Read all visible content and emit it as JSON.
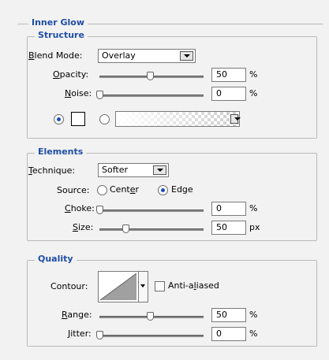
{
  "inner_glow": {
    "title": "Inner Glow",
    "structure": {
      "title": "Structure",
      "blend_mode": {
        "label_prefix": "B",
        "label_rest": "lend Mode:",
        "value": "Overlay"
      },
      "opacity": {
        "label_prefix": "O",
        "label_rest": "pacity:",
        "value": "50",
        "unit": "%",
        "slider_fraction": 0.5
      },
      "noise": {
        "label_prefix": "N",
        "label_rest": "oise:",
        "value": "0",
        "unit": "%",
        "slider_fraction": 0.0
      }
    },
    "elements": {
      "title": "Elements",
      "technique": {
        "label_prefix": "T",
        "label_rest": "echnique:",
        "value": "Softer"
      },
      "source": {
        "label": "Source:",
        "center_prefix": "Cent",
        "center_u": "e",
        "center_rest": "r",
        "edge": "Edge",
        "selected": "Edge"
      },
      "choke": {
        "label_prefix": "C",
        "label_rest": "hoke:",
        "value": "0",
        "unit": "%",
        "slider_fraction": 0.0
      },
      "size": {
        "label_prefix": "S",
        "label_rest": "ize:",
        "value": "50",
        "unit": "px",
        "slider_fraction": 0.25
      }
    },
    "quality": {
      "title": "Quality",
      "contour_label": "Contour:",
      "anti_aliased": {
        "prefix": "Anti-a",
        "u": "l",
        "rest": "iased",
        "checked": false
      },
      "range": {
        "label_prefix": "R",
        "label_rest": "ange:",
        "value": "50",
        "unit": "%",
        "slider_fraction": 0.5
      },
      "jitter": {
        "label_prefix": "J",
        "label_rest": "itter:",
        "value": "0",
        "unit": "%",
        "slider_fraction": 0.0
      }
    }
  }
}
